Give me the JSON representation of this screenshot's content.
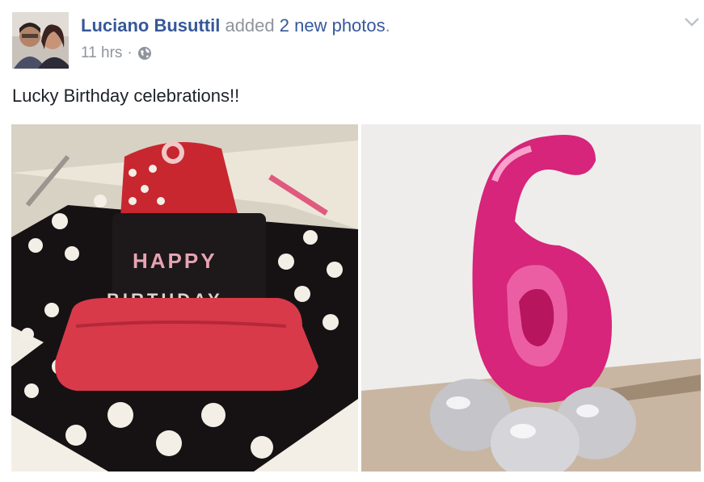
{
  "post": {
    "author": "Luciano Busuttil",
    "action_text": "added",
    "photos_link": "2 new photos",
    "timestamp": "11 hrs",
    "separator": "·",
    "status_text": "Lucky Birthday celebrations!!"
  },
  "icons": {
    "privacy": "globe-icon",
    "menu": "chevron-down-icon"
  },
  "photos": [
    {
      "alt": "birthday cake photo",
      "cake_text_1": "HAPPY",
      "cake_text_2": "BIRTHDAY"
    },
    {
      "alt": "number six balloon photo",
      "digit": "6"
    }
  ]
}
